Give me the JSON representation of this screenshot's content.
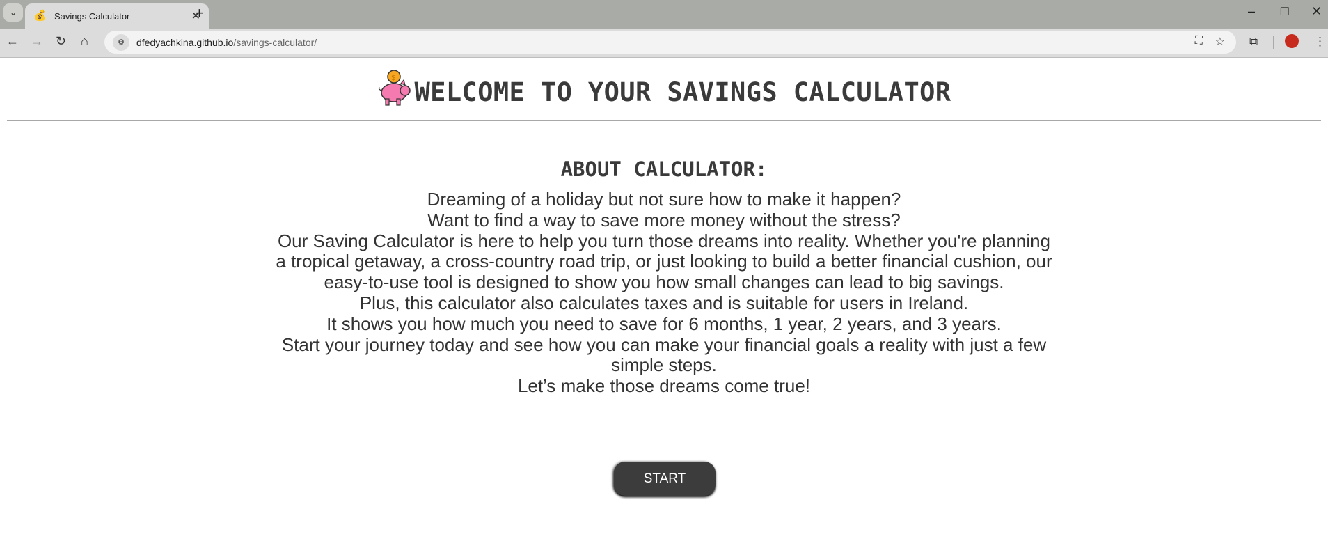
{
  "browser": {
    "tab_title": "Savings Calculator",
    "url_host": "dfedyachkina.github.io",
    "url_path": "/savings-calculator/"
  },
  "page": {
    "title": "WELCOME TO YOUR SAVINGS CALCULATOR",
    "about_heading": "ABOUT CALCULATOR:",
    "paragraphs": [
      "Dreaming of a holiday but not sure how to make it happen?",
      "Want to find a way to save more money without the stress?",
      "Our Saving Calculator is here to help you turn those dreams into reality. Whether you're planning a tropical getaway, a cross-country road trip, or just looking to build a better financial cushion, our easy-to-use tool is designed to show you how small changes can lead to big savings.",
      "Plus, this calculator also calculates taxes and is suitable for users in Ireland.",
      "It shows you how much you need to save for 6 months, 1 year, 2 years, and 3 years.",
      "Start your journey today and see how you can make your financial goals a reality with just a few simple steps.",
      "Let’s make those dreams come true!"
    ],
    "start_label": "START"
  },
  "colors": {
    "text": "#333333",
    "button": "#3c3c3c",
    "pig": "#f57ab0",
    "coin": "#f5a623"
  }
}
